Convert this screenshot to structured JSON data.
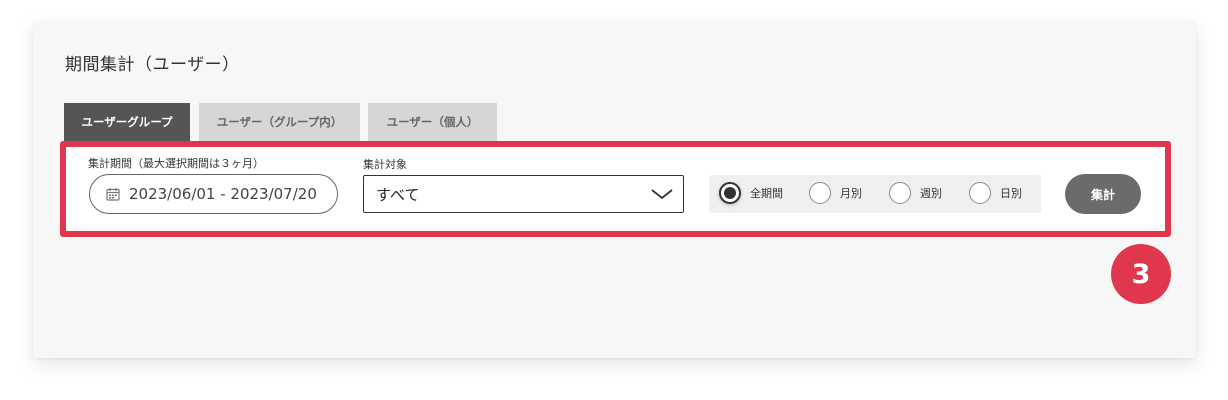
{
  "page": {
    "title": "期間集計（ユーザー）"
  },
  "tabs": [
    {
      "label": "ユーザーグループ",
      "active": true
    },
    {
      "label": "ユーザー（グループ内）",
      "active": false
    },
    {
      "label": "ユーザー（個人）",
      "active": false
    }
  ],
  "filters": {
    "period_label": "集計期間（最大選択期間は３ヶ月）",
    "period_value": "2023/06/01 - 2023/07/20",
    "target_label": "集計対象",
    "target_value": "すべて",
    "granularity": [
      {
        "label": "全期間",
        "checked": true
      },
      {
        "label": "月別",
        "checked": false
      },
      {
        "label": "週別",
        "checked": false
      },
      {
        "label": "日別",
        "checked": false
      }
    ],
    "submit_label": "集計"
  },
  "annotation": {
    "step_number": "3"
  },
  "colors": {
    "highlight": "#e0364e",
    "tab_active": "#555555",
    "tab_inactive": "#d6d6d6",
    "button": "#6b6b6b"
  },
  "icons": {
    "date": "calendar-icon",
    "select": "chevron-down-icon"
  }
}
